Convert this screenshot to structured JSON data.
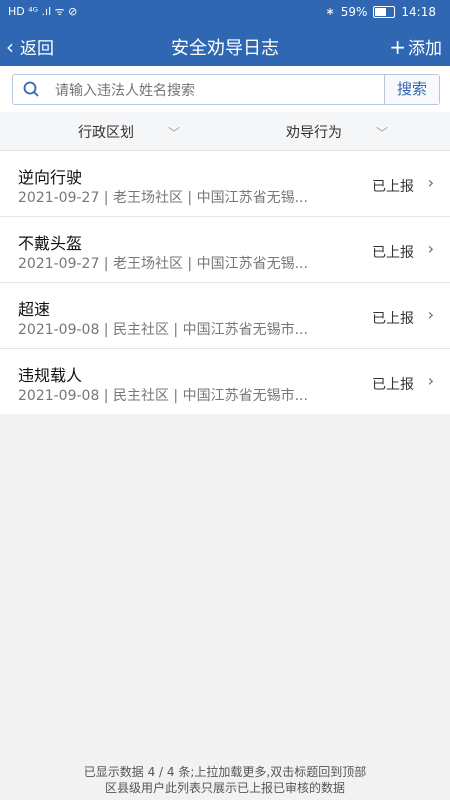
{
  "status_bar": {
    "left_icons": "HD ⁴ᴳ .ıl ᯤ ⊘",
    "right_icons": "∗ ▢",
    "battery_percent": "59%",
    "battery_level": 0.59,
    "time": "14:18"
  },
  "header": {
    "back_label": "返回",
    "title": "安全劝导日志",
    "add_label": "添加"
  },
  "search": {
    "placeholder": "请输入违法人姓名搜索",
    "button_label": "搜索"
  },
  "filters": [
    {
      "label": "行政区划"
    },
    {
      "label": "劝导行为"
    }
  ],
  "records": [
    {
      "name": "逆向行驶",
      "meta": "2021-09-27 | 老王场社区 | 中国江苏省无锡...",
      "status": "已上报"
    },
    {
      "name": "不戴头盔",
      "meta": "2021-09-27 | 老王场社区 | 中国江苏省无锡...",
      "status": "已上报"
    },
    {
      "name": "超速",
      "meta": "2021-09-08 | 民主社区 | 中国江苏省无锡市...",
      "status": "已上报"
    },
    {
      "name": "违规载人",
      "meta": "2021-09-08 | 民主社区 | 中国江苏省无锡市...",
      "status": "已上报"
    }
  ],
  "footer": {
    "line1": "已显示数据 4 / 4 条;上拉加载更多,双击标题回到顶部",
    "line2": "区县级用户此列表只展示已上报已审核的数据"
  },
  "colors": {
    "primary": "#2f67b2",
    "background": "#f2f2f2"
  }
}
